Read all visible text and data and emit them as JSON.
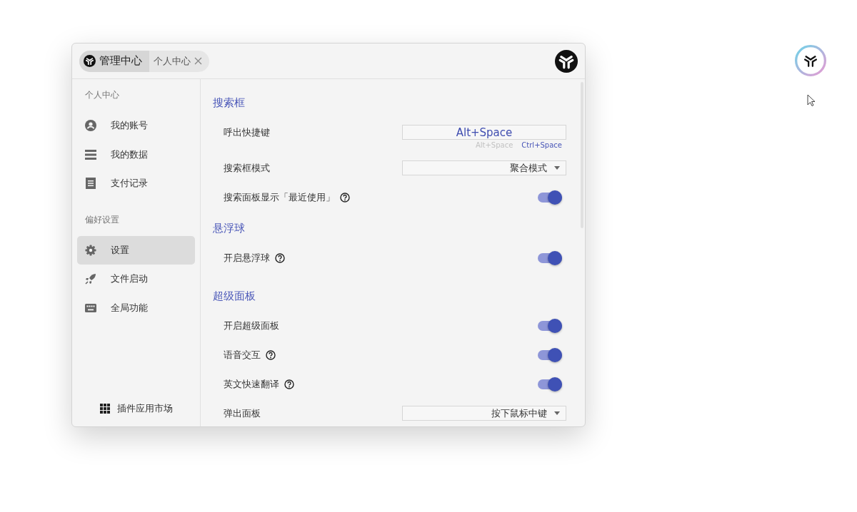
{
  "tabs": [
    {
      "label": "管理中心",
      "selected": true,
      "closable": false
    },
    {
      "label": "个人中心",
      "selected": false,
      "closable": true
    }
  ],
  "sidebar": {
    "groups": [
      {
        "title": "个人中心",
        "items": [
          {
            "label": "我的账号",
            "selected": false
          },
          {
            "label": "我的数据",
            "selected": false
          },
          {
            "label": "支付记录",
            "selected": false
          }
        ]
      },
      {
        "title": "偏好设置",
        "items": [
          {
            "label": "设置",
            "selected": true
          },
          {
            "label": "文件启动",
            "selected": false
          },
          {
            "label": "全局功能",
            "selected": false
          }
        ]
      }
    ],
    "footer": "插件应用市场"
  },
  "sections": [
    {
      "title": "搜索框",
      "rows": [
        {
          "kind": "shortcut",
          "label": "呼出快捷键",
          "value": "Alt+Space",
          "options": [
            {
              "label": "Alt+Space",
              "selected": true
            },
            {
              "label": "Ctrl+Space",
              "selected": false
            }
          ]
        },
        {
          "kind": "select",
          "label": "搜索框模式",
          "value": "聚合模式"
        },
        {
          "kind": "toggle",
          "label": "搜索面板显示「最近使用」",
          "help": true,
          "on": true
        }
      ]
    },
    {
      "title": "悬浮球",
      "rows": [
        {
          "kind": "toggle",
          "label": "开启悬浮球",
          "help": true,
          "on": true
        }
      ]
    },
    {
      "title": "超级面板",
      "rows": [
        {
          "kind": "toggle",
          "label": "开启超级面板",
          "help": false,
          "on": true
        },
        {
          "kind": "toggle",
          "label": "语音交互",
          "help": true,
          "on": true
        },
        {
          "kind": "toggle",
          "label": "英文快速翻译",
          "help": true,
          "on": true
        },
        {
          "kind": "select",
          "label": "弹出面板",
          "value": "按下鼠标中键"
        }
      ]
    }
  ]
}
